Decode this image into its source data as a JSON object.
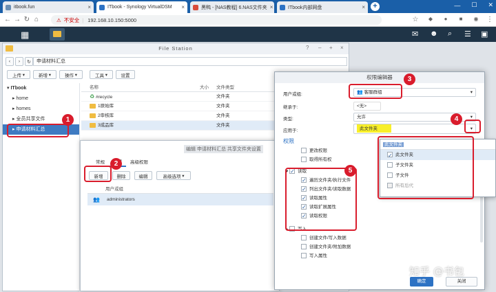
{
  "browser": {
    "tabs": [
      {
        "label": "itbook.fun"
      },
      {
        "label": "ITbook - Synology VirtualDSM"
      },
      {
        "label": "黑鸭 - [NAS教程] 6.NAS文件夹"
      },
      {
        "label": "ITbook内部网盘"
      }
    ],
    "insecure_label": "不安全",
    "url": "192.168.10.150:5000"
  },
  "file_station": {
    "title": "File Station",
    "path": "申请材料汇总",
    "toolbar": [
      "上传",
      "新增",
      "操作",
      "工具",
      "设置"
    ],
    "tree_root": "ITbook",
    "tree": [
      "home",
      "homes",
      "全员共享文件",
      "申请材料汇总"
    ],
    "columns": {
      "name": "名称",
      "size": "大小",
      "type": "文件类型"
    },
    "files": [
      {
        "name": "#recycle",
        "type": "文件夹"
      },
      {
        "name": "1原始库",
        "type": "文件夹"
      },
      {
        "name": "2审核库",
        "type": "文件夹"
      },
      {
        "name": "3成品库",
        "type": "文件夹"
      }
    ]
  },
  "properties": {
    "title": "编辑 申请材料汇总 共享文件夹设置",
    "tabs": [
      "常规",
      "权限",
      "高级权限"
    ],
    "buttons": [
      "新增",
      "删除",
      "编辑",
      "高级选项"
    ],
    "col_user": "用户或组",
    "rows": [
      "administrators"
    ]
  },
  "perm_editor": {
    "title": "权限编辑器",
    "user_label": "用户或组:",
    "user_value": "客服群组",
    "inherit_label": "继承于:",
    "inherit_value": "<无>",
    "type_label": "类型:",
    "type_value": "允许",
    "apply_label": "应用于:",
    "apply_value": "此文件夹",
    "perm_heading": "权限",
    "perm_items_top": [
      "更改权限",
      "取得所有权"
    ],
    "read_group": "读取",
    "read_items": [
      "遍历文件夹/执行文件",
      "列出文件夹/读取数据",
      "读取属性",
      "读取扩展属性",
      "读取权限"
    ],
    "write_group": "写入",
    "write_items": [
      "创建文件/写入数据",
      "创建文件夹/附加数据",
      "写入属性"
    ],
    "ok": "确定",
    "close": "关闭"
  },
  "apply_dropdown": {
    "search": "此文件夹",
    "options": [
      "此文件夹",
      "子文件夹",
      "子文件",
      "所有后代"
    ]
  },
  "markers": [
    "1",
    "2",
    "3",
    "4",
    "5"
  ],
  "watermark": "知乎 @书包"
}
